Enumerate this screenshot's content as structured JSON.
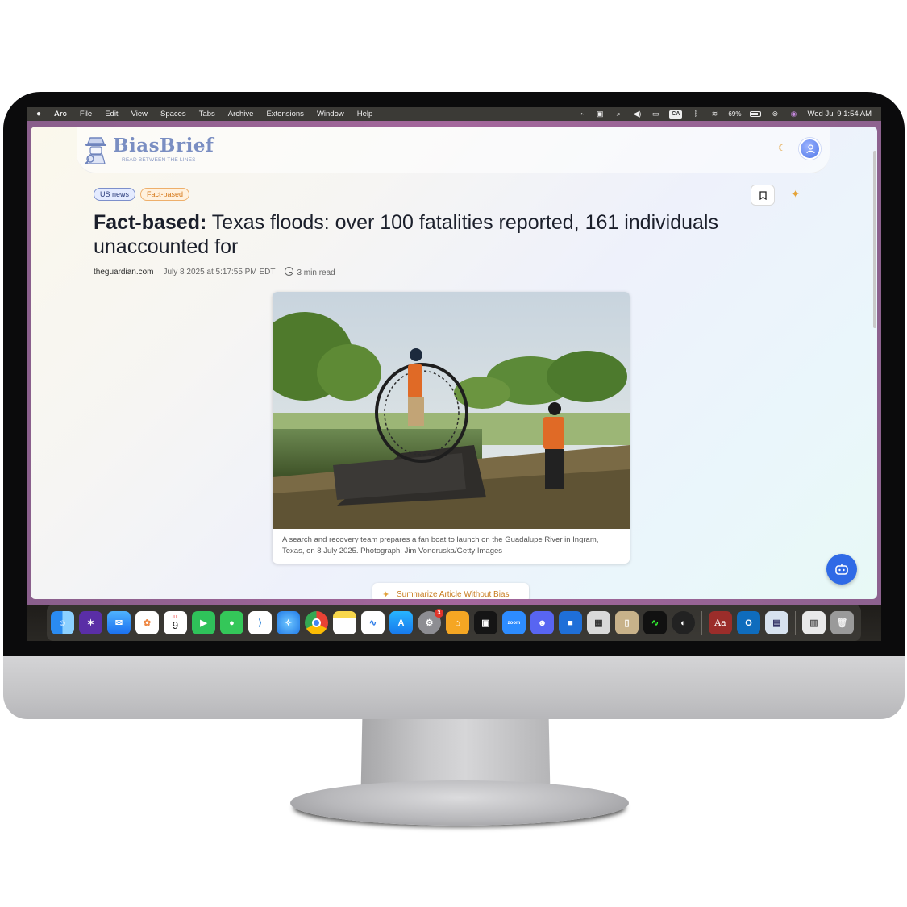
{
  "menubar": {
    "apple": "",
    "items": [
      "Arc",
      "File",
      "Edit",
      "View",
      "Spaces",
      "Tabs",
      "Archive",
      "Extensions",
      "Window",
      "Help"
    ],
    "input_badge": "CA",
    "battery": "69%",
    "datetime": "Wed Jul 9  1:54 AM"
  },
  "header": {
    "logo_title": "BiasBrief",
    "logo_tagline": "READ BETWEEN THE LINES"
  },
  "article": {
    "tags": [
      "US news",
      "Fact-based"
    ],
    "title_prefix": "Fact-based:",
    "title_rest": " Texas floods: over 100 fatalities reported, 161 individuals unaccounted for",
    "source": "theguardian.com",
    "date": "July 8 2025 at 5:17:55 PM EDT",
    "read_time": "3 min read",
    "caption": "A search and recovery team prepares a fan boat to launch on the Guadalupe River in Ingram, Texas, on 8 July 2025. Photograph: Jim Vondruska/Getty Images",
    "summarize_label": "Summarize Article Without Bias"
  },
  "dock": {
    "calendar_month": "JUL",
    "calendar_day": "9",
    "settings_badge": "3",
    "zoom_label": "zoom",
    "dictionary_label": "Aa"
  },
  "colors": {
    "accent_blue": "#2f6ae6",
    "fact_orange": "#d57819",
    "arc_frame": "#a4679c"
  }
}
